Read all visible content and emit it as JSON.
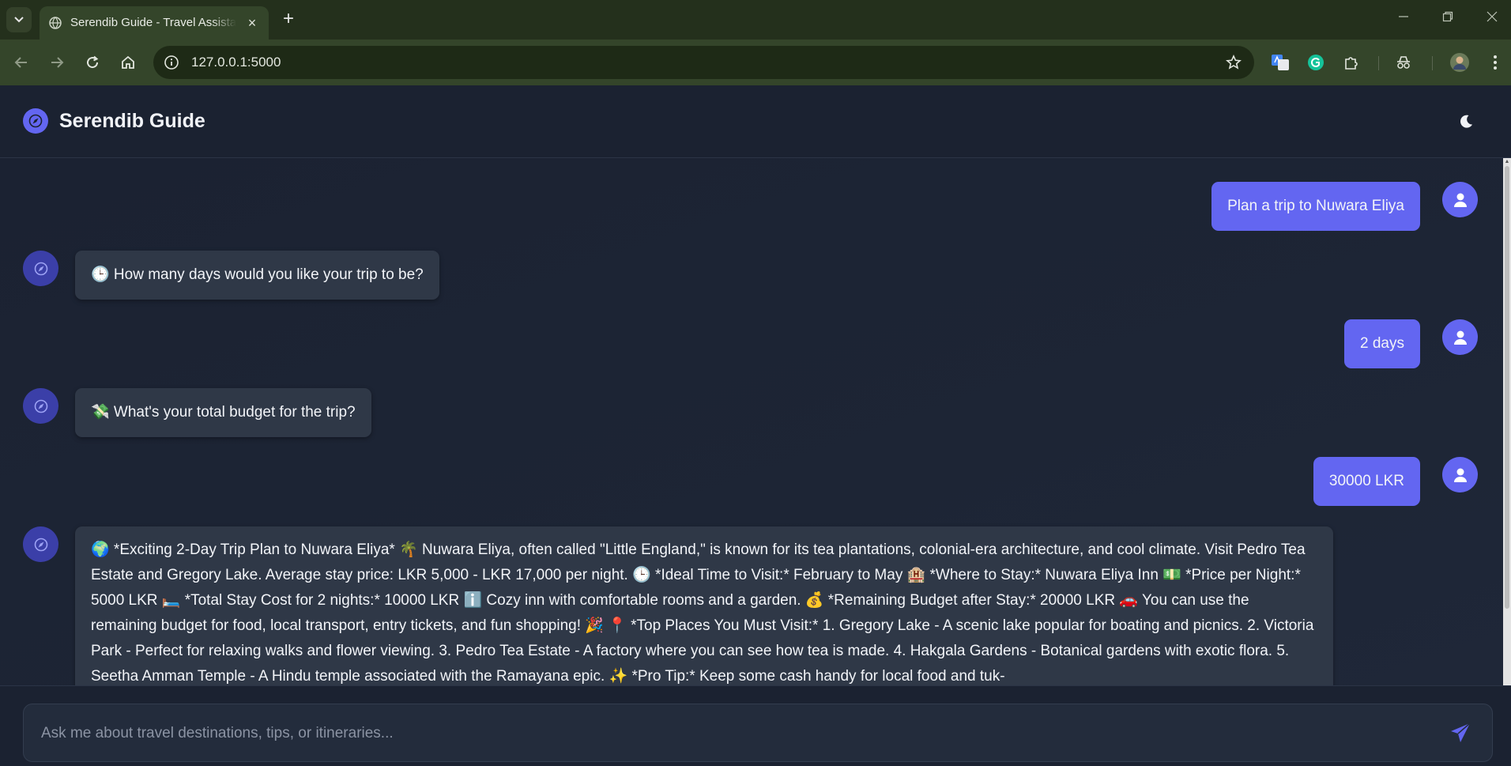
{
  "browser": {
    "tab_title": "Serendib Guide - Travel Assistant",
    "url": "127.0.0.1:5000",
    "new_tab_label": "+",
    "close_tab_label": "×"
  },
  "app": {
    "title": "Serendib Guide",
    "accent_color": "#6366f1",
    "icons": {
      "brand": "compass-icon",
      "theme": "moon-icon",
      "user_avatar": "user-icon",
      "bot_avatar": "compass-icon",
      "send": "paper-plane-icon"
    }
  },
  "messages": [
    {
      "role": "user",
      "text": "Plan a trip to Nuwara Eliya"
    },
    {
      "role": "bot",
      "text": "🕒 How many days would you like your trip to be?"
    },
    {
      "role": "user",
      "text": "2 days"
    },
    {
      "role": "bot",
      "text": "💸 What's your total budget for the trip?"
    },
    {
      "role": "user",
      "text": "30000 LKR"
    },
    {
      "role": "bot",
      "text": "🌍 *Exciting 2-Day Trip Plan to Nuwara Eliya* 🌴 Nuwara Eliya, often called \"Little England,\" is known for its tea plantations, colonial-era architecture, and cool climate. Visit Pedro Tea Estate and Gregory Lake. Average stay price: LKR 5,000 - LKR 17,000 per night. 🕒 *Ideal Time to Visit:* February to May 🏨 *Where to Stay:* Nuwara Eliya Inn 💵 *Price per Night:* 5000 LKR 🛏️ *Total Stay Cost for 2 nights:* 10000 LKR ℹ️ Cozy inn with comfortable rooms and a garden. 💰 *Remaining Budget after Stay:* 20000 LKR 🚗 You can use the remaining budget for food, local transport, entry tickets, and fun shopping! 🎉 📍 *Top Places You Must Visit:* 1. Gregory Lake - A scenic lake popular for boating and picnics. 2. Victoria Park - Perfect for relaxing walks and flower viewing. 3. Pedro Tea Estate - A factory where you can see how tea is made. 4. Hakgala Gardens - Botanical gardens with exotic flora. 5. Seetha Amman Temple - A Hindu temple associated with the Ramayana epic. ✨ *Pro Tip:* Keep some cash handy for local food and tuk-"
    }
  ],
  "composer": {
    "placeholder": "Ask me about travel destinations, tips, or itineraries..."
  }
}
